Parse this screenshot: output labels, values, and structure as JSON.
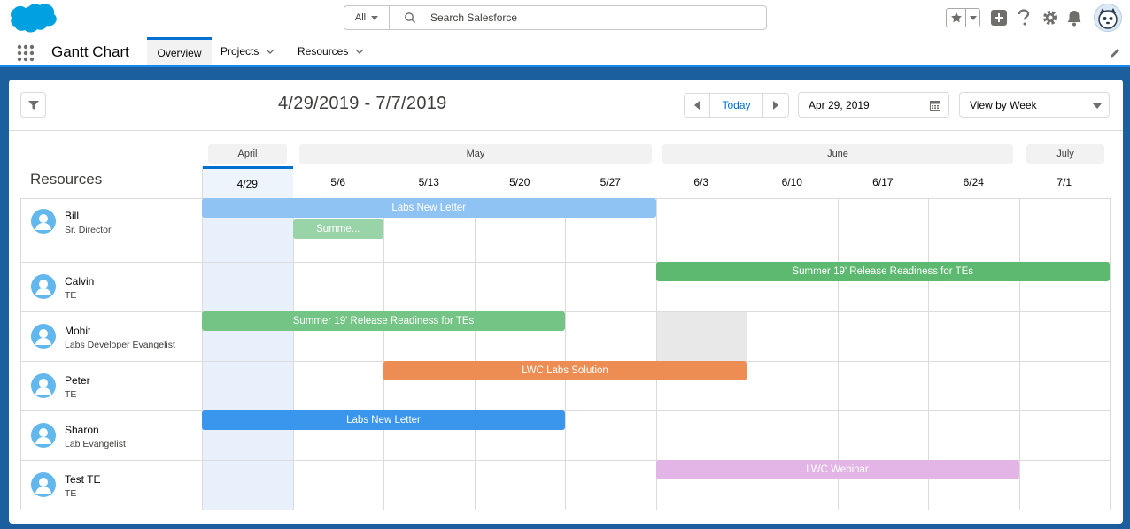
{
  "header": {
    "search_scope": "All",
    "search_placeholder": "Search Salesforce"
  },
  "nav": {
    "app_title": "Gantt Chart",
    "tabs": [
      {
        "label": "Overview",
        "active": true
      },
      {
        "label": "Projects",
        "has_menu": true
      },
      {
        "label": "Resources",
        "has_menu": true
      }
    ]
  },
  "toolbar": {
    "date_range": "4/29/2019 - 7/7/2019",
    "today_label": "Today",
    "date_value": "Apr 29, 2019",
    "view_label": "View by Week"
  },
  "gantt": {
    "resources_title": "Resources",
    "months": [
      "April",
      "May",
      "June",
      "July"
    ],
    "weeks": [
      "4/29",
      "5/6",
      "5/13",
      "5/20",
      "5/27",
      "6/3",
      "6/10",
      "6/17",
      "6/24",
      "7/1"
    ],
    "current_week": "4/29",
    "resources": [
      {
        "name": "Bill",
        "title": "Sr. Director"
      },
      {
        "name": "Calvin",
        "title": "TE"
      },
      {
        "name": "Mohit",
        "title": "Labs Developer Evangelist"
      },
      {
        "name": "Peter",
        "title": "TE"
      },
      {
        "name": "Sharon",
        "title": "Lab Evangelist"
      },
      {
        "name": "Test TE",
        "title": "TE"
      }
    ],
    "allocations": [
      {
        "resource": "Bill",
        "label": "Labs New Letter",
        "start_week": "4/29",
        "end_week": "5/27",
        "color": "#8fc3f4"
      },
      {
        "resource": "Bill",
        "label": "Summe...",
        "start_week": "5/6",
        "end_week": "5/6",
        "color": "#99d4a8"
      },
      {
        "resource": "Calvin",
        "label": "Summer 19' Release Readiness for TEs",
        "start_week": "6/3",
        "end_week": "7/1",
        "color": "#5cb96f"
      },
      {
        "resource": "Mohit",
        "label": "Summer 19' Release Readiness for TEs",
        "start_week": "4/29",
        "end_week": "5/20",
        "color": "#74c585"
      },
      {
        "resource": "Peter",
        "label": "LWC Labs Solution",
        "start_week": "5/13",
        "end_week": "6/3",
        "color": "#ee8d53"
      },
      {
        "resource": "Sharon",
        "label": "Labs New Letter",
        "start_week": "4/29",
        "end_week": "5/20",
        "color": "#3a96ec"
      },
      {
        "resource": "Test TE",
        "label": "LWC Webinar",
        "start_week": "6/3",
        "end_week": "6/24",
        "color": "#e3b5e6"
      }
    ],
    "unavailable": [
      {
        "resource": "Mohit",
        "week": "6/3"
      }
    ]
  }
}
